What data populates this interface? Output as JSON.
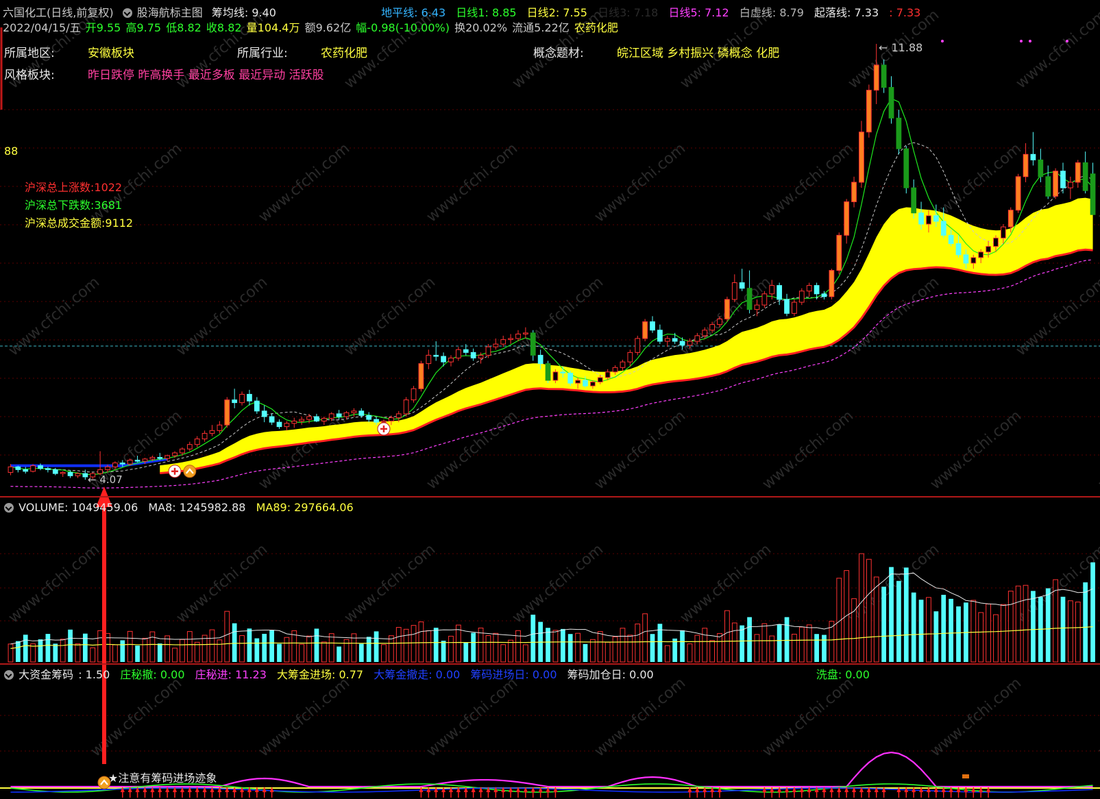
{
  "colors": {
    "background": "#000000",
    "up": "#ff3232",
    "down": "#54ffff",
    "up_big": "#ff8020",
    "down_big": "#1a9a1a",
    "ma1": "#1eea1e",
    "ma2": "#c8c8c8",
    "ma5": "#ff40ff",
    "band": "#ffff00",
    "band_edge": "#ff2020",
    "grid": "#5a0000",
    "dashline": "#3cb8c8",
    "blue": "#1030ff"
  },
  "main": {
    "title": "六国化工(日线,前复权)",
    "indicator_name": "股海航标主图",
    "chip_line": "筹均线: 9.40",
    "ground_line": "地平线: 6.43",
    "day_line1": "日线1: 8.85",
    "day_line2": "日线2: 7.55",
    "day_line3": "日线3: 7.18",
    "day_line5": "日线5: 7.12",
    "white_dash": "白虚线: 8.79",
    "rise_fall": "起落线: 7.33",
    "rise_fall_val": ": 7.33",
    "quote": {
      "date": "2022/04/15/五",
      "open": "开9.55",
      "high": "高9.75",
      "low": "低8.82",
      "close": "收8.82",
      "volume": "量104.4万",
      "amount": "额9.62亿",
      "change": "幅-0.98(-10.00%)",
      "turnover": "换20.02%",
      "float_cap": "流通5.22亿",
      "sector": "农药化肥"
    },
    "info": {
      "region_label": "所属地区:",
      "region_value": "安徽板块",
      "industry_label": "所属行业:",
      "industry_value": "农药化肥",
      "concept_label": "概念题材:",
      "concept_value": "皖江区域 乡村振兴 磷概念 化肥",
      "style_label": "风格板块:",
      "style_value": "昨日跌停 昨高换手 最近多板 最近异动 活跃股"
    },
    "side_value": "88",
    "market": {
      "up_count": "沪深总上涨数:1022",
      "down_count": "沪深总下跌数:3681",
      "turnover": "沪深总成交金额:9112"
    },
    "high_label": "11.88",
    "low_label": "4.07"
  },
  "volume_panel": {
    "volume": "VOLUME: 1049459.06",
    "ma8": "MA8: 1245982.88",
    "ma89": "MA89: 297664.06"
  },
  "chip_panel": {
    "name": "大资金筹码",
    "value": ": 1.50",
    "zhuang_out": "庄秘撤: 0.00",
    "zhuang_in": "庄秘进: 11.23",
    "big_in": "大筹金进场: 0.77",
    "big_out": "大筹金撤走: 0.00",
    "chip_in_day": "筹码进场日: 0.00",
    "chip_add_day": "筹码加仓日: 0.00",
    "wash": "洗盘: 0.00",
    "note": "★注意有筹码进场迹象"
  },
  "watermark": "www.cfchi.com",
  "chart_data": {
    "type": "candlestick",
    "title": "六国化工(日线,前复权)",
    "y_price_range": [
      4.07,
      11.88
    ],
    "candles": [
      [
        4.2,
        4.35,
        4.15,
        4.3
      ],
      [
        4.3,
        4.32,
        4.2,
        4.25
      ],
      [
        4.25,
        4.3,
        4.18,
        4.22
      ],
      [
        4.22,
        4.35,
        4.2,
        4.32
      ],
      [
        4.32,
        4.36,
        4.24,
        4.27
      ],
      [
        4.27,
        4.3,
        4.2,
        4.25
      ],
      [
        4.25,
        4.28,
        4.15,
        4.18
      ],
      [
        4.18,
        4.22,
        4.12,
        4.2
      ],
      [
        4.2,
        4.24,
        4.1,
        4.14
      ],
      [
        4.14,
        4.2,
        4.1,
        4.18
      ],
      [
        4.18,
        4.25,
        4.07,
        4.12
      ],
      [
        4.12,
        4.2,
        4.08,
        4.18
      ],
      [
        4.18,
        4.58,
        4.15,
        4.25
      ],
      [
        4.25,
        4.34,
        4.2,
        4.3
      ],
      [
        4.3,
        4.4,
        4.25,
        4.37
      ],
      [
        4.37,
        4.42,
        4.3,
        4.35
      ],
      [
        4.35,
        4.45,
        4.32,
        4.42
      ],
      [
        4.42,
        4.5,
        4.38,
        4.4
      ],
      [
        4.4,
        4.46,
        4.35,
        4.44
      ],
      [
        4.44,
        4.5,
        4.4,
        4.47
      ],
      [
        4.47,
        4.55,
        4.42,
        4.45
      ],
      [
        4.45,
        4.52,
        4.4,
        4.5
      ],
      [
        4.5,
        4.58,
        4.46,
        4.55
      ],
      [
        4.55,
        4.65,
        4.5,
        4.62
      ],
      [
        4.62,
        4.75,
        4.58,
        4.7
      ],
      [
        4.7,
        4.85,
        4.65,
        4.8
      ],
      [
        4.8,
        4.95,
        4.75,
        4.9
      ],
      [
        4.9,
        5.05,
        4.85,
        4.95
      ],
      [
        4.95,
        5.12,
        4.9,
        5.05
      ],
      [
        5.05,
        5.55,
        5.0,
        5.5
      ],
      [
        5.5,
        5.7,
        5.35,
        5.45
      ],
      [
        5.45,
        5.65,
        5.4,
        5.6
      ],
      [
        5.6,
        5.68,
        5.4,
        5.48
      ],
      [
        5.48,
        5.55,
        5.25,
        5.3
      ],
      [
        5.3,
        5.4,
        5.1,
        5.2
      ],
      [
        5.2,
        5.25,
        5.05,
        5.1
      ],
      [
        5.1,
        5.15,
        4.98,
        5.02
      ],
      [
        5.02,
        5.12,
        4.95,
        5.08
      ],
      [
        5.08,
        5.18,
        5.0,
        5.12
      ],
      [
        5.12,
        5.2,
        5.05,
        5.15
      ],
      [
        5.15,
        5.25,
        5.08,
        5.2
      ],
      [
        5.2,
        5.25,
        5.1,
        5.12
      ],
      [
        5.12,
        5.2,
        5.05,
        5.17
      ],
      [
        5.17,
        5.28,
        5.12,
        5.25
      ],
      [
        5.25,
        5.32,
        5.15,
        5.2
      ],
      [
        5.2,
        5.3,
        5.15,
        5.27
      ],
      [
        5.27,
        5.35,
        5.2,
        5.3
      ],
      [
        5.3,
        5.35,
        5.18,
        5.22
      ],
      [
        5.22,
        5.28,
        5.1,
        5.15
      ],
      [
        5.15,
        5.2,
        5.05,
        5.1
      ],
      [
        5.1,
        5.15,
        5.0,
        5.12
      ],
      [
        5.12,
        5.22,
        5.05,
        5.18
      ],
      [
        5.18,
        5.3,
        5.1,
        5.25
      ],
      [
        5.25,
        5.55,
        5.2,
        5.5
      ],
      [
        5.5,
        5.75,
        5.45,
        5.7
      ],
      [
        5.7,
        6.2,
        5.65,
        6.15
      ],
      [
        6.15,
        6.4,
        6.05,
        6.3
      ],
      [
        6.3,
        6.55,
        6.2,
        6.28
      ],
      [
        6.28,
        6.35,
        6.1,
        6.18
      ],
      [
        6.18,
        6.3,
        6.1,
        6.25
      ],
      [
        6.25,
        6.45,
        6.2,
        6.4
      ],
      [
        6.4,
        6.5,
        6.3,
        6.35
      ],
      [
        6.35,
        6.42,
        6.2,
        6.25
      ],
      [
        6.25,
        6.35,
        6.15,
        6.3
      ],
      [
        6.3,
        6.5,
        6.25,
        6.45
      ],
      [
        6.45,
        6.6,
        6.4,
        6.5
      ],
      [
        6.5,
        6.65,
        6.45,
        6.58
      ],
      [
        6.58,
        6.68,
        6.5,
        6.6
      ],
      [
        6.6,
        6.75,
        6.55,
        6.68
      ],
      [
        6.68,
        6.8,
        6.6,
        6.7
      ],
      [
        6.7,
        6.75,
        6.2,
        6.3
      ],
      [
        6.3,
        6.4,
        6.05,
        6.15
      ],
      [
        6.15,
        6.2,
        5.8,
        5.85
      ],
      [
        5.85,
        6.05,
        5.8,
        6.0
      ],
      [
        6.0,
        6.1,
        5.9,
        5.98
      ],
      [
        5.98,
        6.02,
        5.75,
        5.8
      ],
      [
        5.8,
        5.9,
        5.7,
        5.85
      ],
      [
        5.85,
        5.92,
        5.72,
        5.75
      ],
      [
        5.75,
        5.85,
        5.7,
        5.82
      ],
      [
        5.82,
        5.95,
        5.78,
        5.9
      ],
      [
        5.9,
        6.05,
        5.85,
        6.0
      ],
      [
        6.0,
        6.12,
        5.95,
        6.08
      ],
      [
        6.08,
        6.22,
        6.02,
        6.18
      ],
      [
        6.18,
        6.4,
        6.1,
        6.35
      ],
      [
        6.35,
        6.65,
        6.3,
        6.6
      ],
      [
        6.6,
        6.95,
        6.55,
        6.9
      ],
      [
        6.9,
        7.0,
        6.7,
        6.75
      ],
      [
        6.75,
        6.85,
        6.5,
        6.55
      ],
      [
        6.55,
        6.65,
        6.45,
        6.6
      ],
      [
        6.6,
        6.7,
        6.5,
        6.55
      ],
      [
        6.55,
        6.62,
        6.4,
        6.48
      ],
      [
        6.48,
        6.6,
        6.42,
        6.55
      ],
      [
        6.55,
        6.7,
        6.5,
        6.65
      ],
      [
        6.65,
        6.8,
        6.6,
        6.75
      ],
      [
        6.75,
        6.9,
        6.7,
        6.85
      ],
      [
        6.85,
        7.0,
        6.8,
        6.95
      ],
      [
        6.95,
        7.35,
        6.9,
        7.3
      ],
      [
        7.3,
        7.75,
        7.25,
        7.6
      ],
      [
        7.6,
        7.85,
        7.45,
        7.5
      ],
      [
        7.5,
        7.82,
        7.05,
        7.12
      ],
      [
        7.12,
        7.3,
        7.0,
        7.2
      ],
      [
        7.2,
        7.45,
        7.15,
        7.4
      ],
      [
        7.4,
        7.65,
        7.3,
        7.55
      ],
      [
        7.55,
        7.6,
        7.2,
        7.3
      ],
      [
        7.3,
        7.4,
        7.0,
        7.05
      ],
      [
        7.05,
        7.3,
        7.0,
        7.25
      ],
      [
        7.25,
        7.5,
        7.2,
        7.45
      ],
      [
        7.45,
        7.6,
        7.35,
        7.55
      ],
      [
        7.55,
        7.6,
        7.3,
        7.4
      ],
      [
        7.4,
        7.45,
        7.3,
        7.35
      ],
      [
        7.35,
        7.85,
        7.3,
        7.82
      ],
      [
        7.82,
        8.5,
        7.75,
        8.45
      ],
      [
        8.45,
        9.1,
        8.3,
        9.05
      ],
      [
        9.05,
        9.5,
        8.95,
        9.4
      ],
      [
        9.4,
        10.5,
        9.3,
        10.3
      ],
      [
        10.3,
        11.15,
        10.2,
        11.05
      ],
      [
        11.05,
        11.88,
        10.8,
        11.5
      ],
      [
        11.5,
        11.6,
        11.0,
        11.1
      ],
      [
        11.1,
        11.3,
        10.45,
        10.55
      ],
      [
        10.55,
        10.7,
        9.9,
        10.0
      ],
      [
        10.0,
        10.05,
        9.2,
        9.3
      ],
      [
        9.3,
        9.45,
        8.75,
        8.85
      ],
      [
        8.85,
        9.05,
        8.55,
        8.65
      ],
      [
        8.65,
        8.9,
        8.5,
        8.8
      ],
      [
        8.8,
        9.0,
        8.6,
        8.7
      ],
      [
        8.7,
        8.95,
        8.4,
        8.45
      ],
      [
        8.45,
        8.55,
        8.25,
        8.3
      ],
      [
        8.3,
        8.45,
        8.05,
        8.1
      ],
      [
        8.1,
        8.2,
        7.85,
        7.95
      ],
      [
        7.95,
        8.1,
        7.85,
        8.05
      ],
      [
        8.05,
        8.2,
        7.95,
        8.15
      ],
      [
        8.15,
        8.35,
        8.05,
        8.25
      ],
      [
        8.25,
        8.45,
        8.15,
        8.4
      ],
      [
        8.4,
        8.65,
        8.3,
        8.6
      ],
      [
        8.6,
        8.95,
        8.5,
        8.9
      ],
      [
        8.9,
        9.55,
        8.85,
        9.5
      ],
      [
        9.5,
        10.1,
        9.4,
        9.9
      ],
      [
        9.9,
        10.3,
        9.7,
        9.8
      ],
      [
        9.8,
        10.0,
        9.4,
        9.5
      ],
      [
        9.5,
        9.7,
        9.1,
        9.15
      ],
      [
        9.15,
        9.65,
        9.1,
        9.6
      ],
      [
        9.6,
        9.75,
        9.2,
        9.3
      ],
      [
        9.3,
        9.5,
        9.1,
        9.4
      ],
      [
        9.4,
        9.8,
        9.3,
        9.75
      ],
      [
        9.75,
        9.95,
        9.2,
        9.25
      ],
      [
        9.55,
        9.75,
        8.82,
        8.82
      ]
    ],
    "volume_ma8": 1245982.88,
    "volume_ma89": 297664.06,
    "last_volume": 1049459.06
  }
}
